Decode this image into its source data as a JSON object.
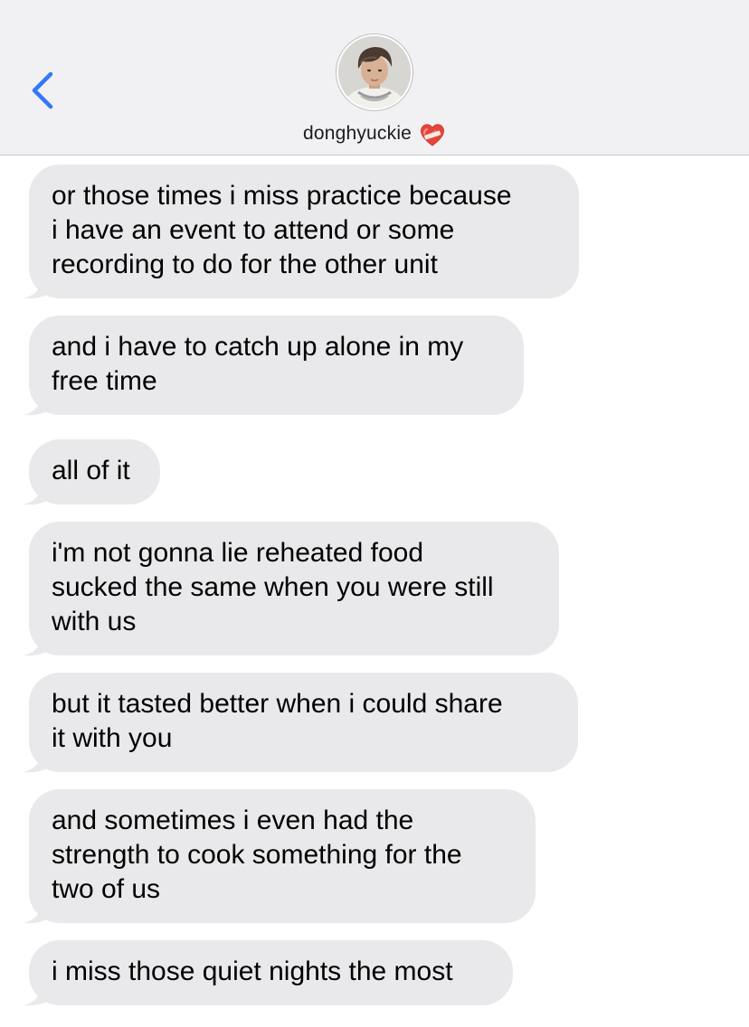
{
  "header": {
    "contact_name": "donghyuckie",
    "contact_emoji": "mending-heart-emoji",
    "back_icon": "chevron-left-icon",
    "avatar": "contact-photo"
  },
  "colors": {
    "header_bg": "#f1f1f3",
    "accent": "#3478f6",
    "bubble_bg": "#e9e9eb",
    "text": "#000000"
  },
  "messages": [
    {
      "text": "or those times i miss practice because\ni have an event to attend or some\nrecording to do for the other unit"
    },
    {
      "text": "and i have to catch up alone in my\nfree time"
    },
    {
      "text": "all of it"
    },
    {
      "text": "i'm not gonna lie reheated food\nsucked the same when you were still\nwith us"
    },
    {
      "text": "but it tasted better when i could share\nit with you"
    },
    {
      "text": "and sometimes i even had the\nstrength to cook something for the\ntwo of us"
    },
    {
      "text": "i miss those quiet nights the most"
    }
  ]
}
